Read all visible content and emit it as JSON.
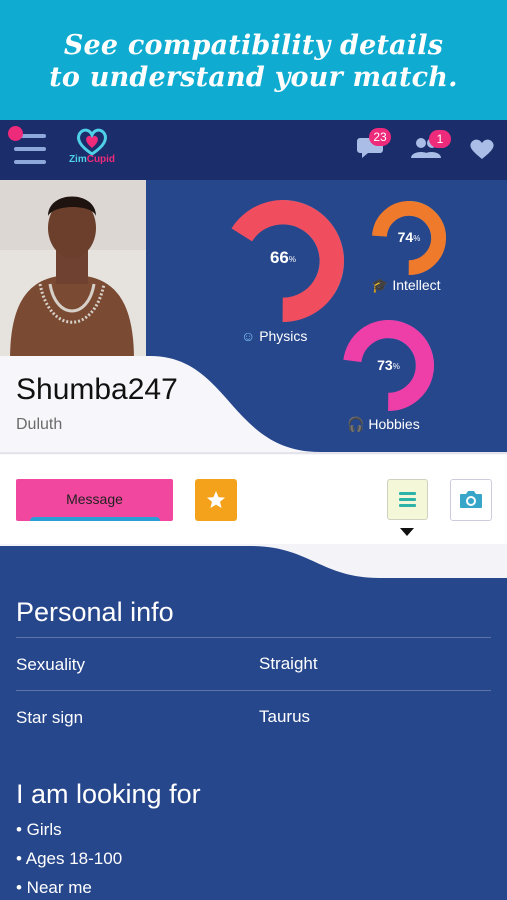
{
  "banner": {
    "line1": "See compatibility details",
    "line2": "to understand your match."
  },
  "app": {
    "logo_part1": "Zim",
    "logo_part2": "Cupid"
  },
  "topbar": {
    "messages_count": "23",
    "friends_count": "1",
    "icons": [
      "menu-icon",
      "chat-bubble-icon",
      "people-icon",
      "heart-icon"
    ]
  },
  "profile": {
    "username": "Shumba247",
    "city": "Duluth",
    "photo_alt": "Profile photo"
  },
  "compatibility": [
    {
      "name": "Physics",
      "value": 66,
      "icon": "smiley-icon",
      "colors": [
        "#f04e5e",
        "#25b6f0"
      ]
    },
    {
      "name": "Intellect",
      "value": 74,
      "icon": "graduation-cap-icon",
      "colors": [
        "#f07a2c",
        "#1dc2dd"
      ]
    },
    {
      "name": "Hobbies",
      "value": 73,
      "icon": "headphones-icon",
      "colors": [
        "#ee3fa9",
        "#3f84e8"
      ]
    }
  ],
  "percent_symbol": "%",
  "actions": {
    "message_label": "Message"
  },
  "personal_info": {
    "title": "Personal info",
    "rows": [
      {
        "label": "Sexuality",
        "value": "Straight"
      },
      {
        "label": "Star sign",
        "value": "Taurus"
      }
    ]
  },
  "looking_for": {
    "title": "I am looking for",
    "items": [
      "• Girls",
      "• Ages 18-100",
      "• Near me"
    ]
  },
  "colors": {
    "banner": "#10abd0",
    "topbar": "#1b2d6a",
    "body": "#27478c",
    "accent_pink": "#ee2a7b"
  }
}
